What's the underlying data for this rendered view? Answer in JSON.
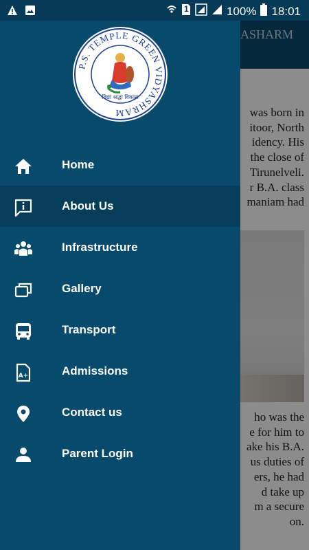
{
  "status_bar": {
    "battery_percent": "100%",
    "time": "18:01",
    "sim_label": "1"
  },
  "background_page": {
    "title_fragment": "ASHARM",
    "paragraph1": [
      "was born in",
      "itoor, North",
      "idency. His",
      "the close of",
      "Tirunelveli.",
      "r B.A. class",
      "maniam had"
    ],
    "paragraph2": [
      "ho was the",
      "e for him to",
      "ake his B.A.",
      "us duties of",
      "ers, he had",
      "d take up",
      "m a secure",
      "on."
    ]
  },
  "logo": {
    "ring_text": "P.S. TEMPLE GREEN VIDYASHRAM",
    "motto": "विद्या श्रद्धा विकास"
  },
  "menu": [
    {
      "label": "Home",
      "icon": "home-icon",
      "active": false
    },
    {
      "label": "About Us",
      "icon": "info-message-icon",
      "active": true
    },
    {
      "label": "Infrastructure",
      "icon": "people-icon",
      "active": false
    },
    {
      "label": "Gallery",
      "icon": "gallery-icon",
      "active": false
    },
    {
      "label": "Transport",
      "icon": "bus-icon",
      "active": false
    },
    {
      "label": "Admissions",
      "icon": "admission-form-icon",
      "active": false
    },
    {
      "label": "Contact us",
      "icon": "location-pin-icon",
      "active": false
    },
    {
      "label": "Parent Login",
      "icon": "person-icon",
      "active": false
    }
  ],
  "colors": {
    "drawer_bg": "#074a6b",
    "active_item_bg": "#063d5a",
    "status_bar_bg": "#063a56",
    "text": "#ffffff"
  }
}
